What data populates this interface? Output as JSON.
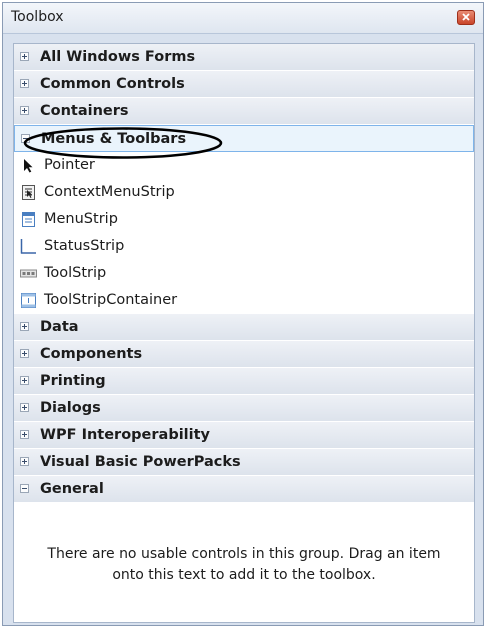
{
  "window": {
    "title": "Toolbox"
  },
  "groups_top": [
    {
      "label": "All Windows Forms",
      "expanded": false
    },
    {
      "label": "Common Controls",
      "expanded": false
    },
    {
      "label": "Containers",
      "expanded": false
    },
    {
      "label": "Menus & Toolbars",
      "expanded": true,
      "selected": true
    }
  ],
  "menus_toolbars_items": [
    {
      "label": "Pointer",
      "icon": "pointer-icon"
    },
    {
      "label": "ContextMenuStrip",
      "icon": "context-menu-strip-icon"
    },
    {
      "label": "MenuStrip",
      "icon": "menu-strip-icon"
    },
    {
      "label": "StatusStrip",
      "icon": "status-strip-icon"
    },
    {
      "label": "ToolStrip",
      "icon": "tool-strip-icon"
    },
    {
      "label": "ToolStripContainer",
      "icon": "tool-strip-container-icon"
    }
  ],
  "groups_bottom": [
    {
      "label": "Data",
      "expanded": false
    },
    {
      "label": "Components",
      "expanded": false
    },
    {
      "label": "Printing",
      "expanded": false
    },
    {
      "label": "Dialogs",
      "expanded": false
    },
    {
      "label": "WPF Interoperability",
      "expanded": false
    },
    {
      "label": "Visual Basic PowerPacks",
      "expanded": false
    },
    {
      "label": "General",
      "expanded": true
    }
  ],
  "general_empty_message": "There are no usable controls in this group. Drag an item onto this text to add it to the toolbox.",
  "colors": {
    "selection_border": "#7eb4ea",
    "close_button": "#c9452a",
    "annotation_ellipse": "#000000"
  }
}
